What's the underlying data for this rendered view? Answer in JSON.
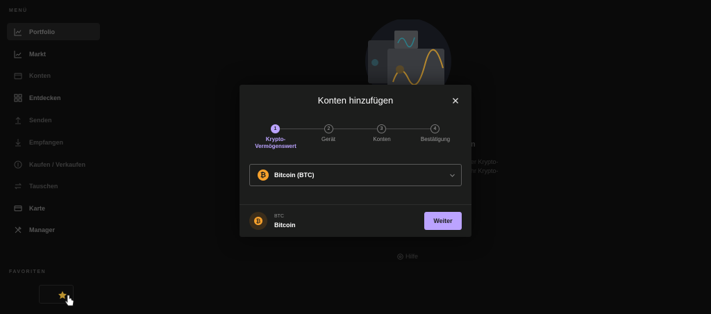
{
  "sidebar": {
    "menu_heading": "MENÜ",
    "items": [
      {
        "label": "Portfolio",
        "icon": "chart-line-icon"
      },
      {
        "label": "Markt",
        "icon": "trend-icon"
      },
      {
        "label": "Konten",
        "icon": "wallet-icon"
      },
      {
        "label": "Entdecken",
        "icon": "grid-icon"
      },
      {
        "label": "Senden",
        "icon": "arrow-up-icon"
      },
      {
        "label": "Empfangen",
        "icon": "arrow-down-icon"
      },
      {
        "label": "Kaufen / Verkaufen",
        "icon": "coin-icon"
      },
      {
        "label": "Tauschen",
        "icon": "swap-icon"
      },
      {
        "label": "Karte",
        "icon": "card-icon"
      },
      {
        "label": "Manager",
        "icon": "tools-icon"
      }
    ],
    "favorites_heading": "FAVORITEN"
  },
  "background": {
    "heading_fragment": "n",
    "text_line1": "er Krypto-",
    "text_line2": "hr Krypto-",
    "help_label": "Hilfe"
  },
  "modal": {
    "title": "Konten hinzufügen",
    "steps": [
      {
        "number": "1",
        "label": "Krypto-Vermögenswert",
        "label_line1": "Krypto-",
        "label_line2": "Vermögenswert",
        "active": true
      },
      {
        "number": "2",
        "label": "Gerät",
        "active": false
      },
      {
        "number": "3",
        "label": "Konten",
        "active": false
      },
      {
        "number": "4",
        "label": "Bestätigung",
        "active": false
      }
    ],
    "select": {
      "value": "Bitcoin (BTC)",
      "coin_symbol": "₿"
    },
    "footer": {
      "ticker": "BTC",
      "name": "Bitcoin",
      "coin_symbol": "₿"
    },
    "continue_label": "Weiter"
  },
  "colors": {
    "accent": "#bba3ff",
    "bitcoin": "#f7a12c",
    "modal_bg": "#1c1d1c",
    "page_bg": "#0a0a0a"
  }
}
